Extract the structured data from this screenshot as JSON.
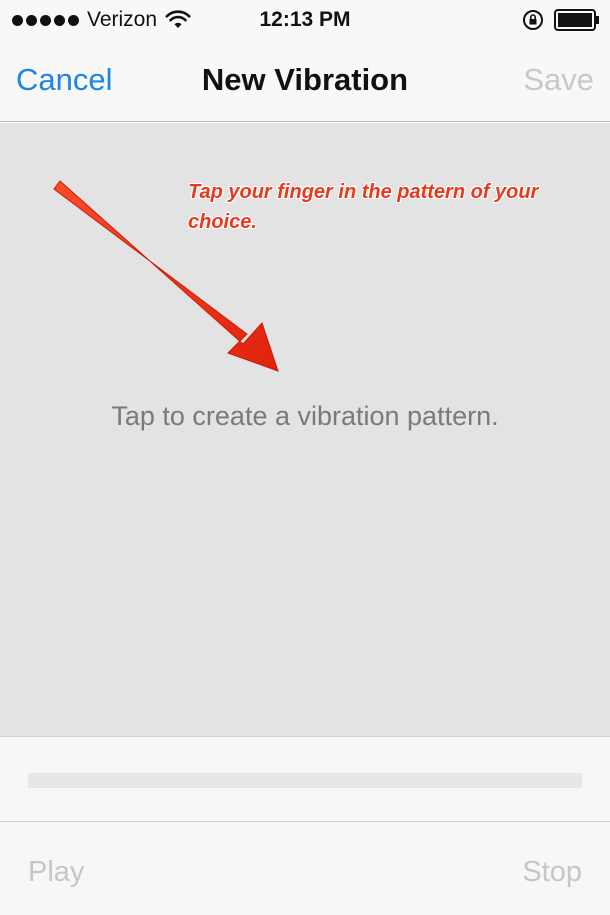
{
  "status_bar": {
    "carrier": "Verizon",
    "time": "12:13 PM",
    "icons": [
      "signal-dots-icon",
      "wifi-icon",
      "rotation-lock-icon",
      "battery-icon"
    ]
  },
  "nav": {
    "cancel_label": "Cancel",
    "title": "New Vibration",
    "save_label": "Save"
  },
  "tap_area": {
    "annotation": "Tap your finger in the pattern of your choice.",
    "hint": "Tap to create a vibration pattern."
  },
  "progress": {
    "value": 0
  },
  "controls": {
    "play_label": "Play",
    "stop_label": "Stop"
  },
  "colors": {
    "accent": "#1e86e0",
    "disabled": "#c6c6c6",
    "annotation": "#e8391b",
    "tap_area_bg": "#e3e3e3"
  }
}
